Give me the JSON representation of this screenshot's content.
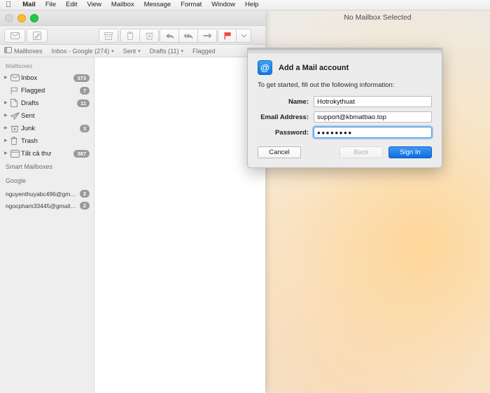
{
  "menubar": {
    "apple_icon": "apple-logo-icon",
    "items": [
      {
        "label": "Mail",
        "bold": true
      },
      {
        "label": "File",
        "bold": false
      },
      {
        "label": "Edit",
        "bold": false
      },
      {
        "label": "View",
        "bold": false
      },
      {
        "label": "Mailbox",
        "bold": false
      },
      {
        "label": "Message",
        "bold": false
      },
      {
        "label": "Format",
        "bold": false
      },
      {
        "label": "Window",
        "bold": false
      },
      {
        "label": "Help",
        "bold": false
      }
    ]
  },
  "window": {
    "title": "No Mailbox Selected",
    "traffic_lights": {
      "close": "close-button",
      "minimize": "minimize-button",
      "maximize": "maximize-button"
    }
  },
  "toolbar": {
    "buttons": [
      {
        "name": "get-mail-button",
        "icon": "envelope-icon"
      },
      {
        "name": "compose-button",
        "icon": "compose-pencil-icon"
      },
      {
        "name": "archive-button",
        "icon": "archive-box-icon"
      },
      {
        "name": "delete-button",
        "icon": "trash-icon"
      },
      {
        "name": "junk-button",
        "icon": "junk-thumb-icon"
      },
      {
        "name": "reply-button",
        "icon": "reply-arrow-icon"
      },
      {
        "name": "reply-all-button",
        "icon": "reply-all-arrow-icon"
      },
      {
        "name": "forward-button",
        "icon": "forward-arrow-icon"
      },
      {
        "name": "flag-button",
        "icon": "flag-icon"
      },
      {
        "name": "flag-dropdown-button",
        "icon": "chevron-down-icon"
      }
    ],
    "flag_color": "#f4423c"
  },
  "favorites_bar": {
    "items": [
      {
        "label": "Mailboxes",
        "icon": "sidebar-toggle-icon",
        "chevron": false
      },
      {
        "label": "Inbox - Google (274)",
        "icon": "",
        "chevron": true
      },
      {
        "label": "Sent",
        "icon": "",
        "chevron": true
      },
      {
        "label": "Drafts (11)",
        "icon": "",
        "chevron": true
      },
      {
        "label": "Flagged",
        "icon": "",
        "chevron": false
      }
    ],
    "chevron_glyph": "▾"
  },
  "sidebar": {
    "section_mailboxes": "Mailboxes",
    "mailboxes": [
      {
        "label": "Inbox",
        "badge": "373",
        "icon": "inbox-tray-icon",
        "triangle": true
      },
      {
        "label": "Flagged",
        "badge": "7",
        "icon": "flag-outline-icon",
        "triangle": false
      },
      {
        "label": "Drafts",
        "badge": "11",
        "icon": "draft-page-icon",
        "triangle": true
      },
      {
        "label": "Sent",
        "badge": "",
        "icon": "paper-plane-icon",
        "triangle": true
      },
      {
        "label": "Junk",
        "badge": "3",
        "icon": "junk-bin-icon",
        "triangle": true
      },
      {
        "label": "Trash",
        "badge": "",
        "icon": "trash-icon",
        "triangle": true
      },
      {
        "label": "Tất cả thư",
        "badge": "387",
        "icon": "all-mail-box-icon",
        "triangle": true
      }
    ],
    "section_smart": "Smart Mailboxes",
    "section_google": "Google",
    "accounts": [
      {
        "label": "nguyenthuyabc496@gmail....",
        "badge": "2"
      },
      {
        "label": "ngocpham33445@gmail.com",
        "badge": "2"
      }
    ]
  },
  "sheet": {
    "icon": "at-sign-icon",
    "icon_glyph": "@",
    "title": "Add a Mail account",
    "subtitle": "To get started, fill out the following information:",
    "fields": [
      {
        "label": "Name:",
        "value": "Hotrokythuat",
        "type": "text",
        "focused": false
      },
      {
        "label": "Email Address:",
        "value": "support@kbmatbao.top",
        "type": "text",
        "focused": false
      },
      {
        "label": "Password:",
        "value": "●●●●●●●●",
        "type": "password",
        "focused": true
      }
    ],
    "buttons": {
      "cancel": "Cancel",
      "back": "Back",
      "signin": "Sign In"
    },
    "accent_color": "#0d6ee0"
  }
}
